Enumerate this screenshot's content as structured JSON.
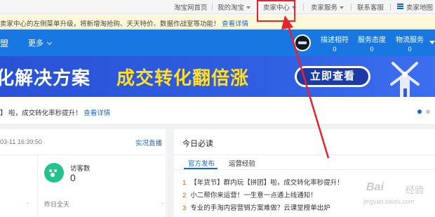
{
  "topnav": {
    "home": "淘宝网首页",
    "my_taobao": "我的淘宝",
    "seller_center": "卖家中心",
    "seller_service": "卖家服务",
    "contact": "联系客服",
    "seller_map": "卖家地图"
  },
  "notice": {
    "text": "卖家中心的左侧菜单升级，将新增淘抢购、天天特价、数据作战室等功能！",
    "link": "查看详情"
  },
  "header": {
    "brand": "盟",
    "more": "更多",
    "metrics": [
      {
        "label": "描述相符",
        "value": "0"
      },
      {
        "label": "服务态度",
        "value": "0"
      },
      {
        "label": "物流服务",
        "value": "0"
      }
    ]
  },
  "banner": {
    "text_white": "化解决方案",
    "text_yellow": "成交转化翻倍涨",
    "cta": "立即查看"
  },
  "news_bar": {
    "text": "】 啦，成交转化率秒提升！",
    "link": "查看详情"
  },
  "left_card": {
    "time": "03-11 16:39:50",
    "live": "实况直播",
    "visitors_label": "访客数",
    "visitors_value": "0",
    "dash_left": "-",
    "yesterday": "昨日全天",
    "dash_right": "-"
  },
  "right_card": {
    "title": "今日必读",
    "tabs": [
      "官方发布",
      "运营经验"
    ],
    "news": [
      {
        "n": "1",
        "text": "【年货节】群内玩【拼团】啦，成交转化率秒提升！"
      },
      {
        "n": "2",
        "text": "小二帮你来运营！一生意一点通上线通知！"
      },
      {
        "n": "3",
        "text": "专业的手淘内容营销方案难做？云课堂榜单出炉"
      }
    ]
  },
  "watermark": {
    "logo": "Bai",
    "logo2": "经验",
    "url": "jingyan.baidu.com"
  },
  "colors": {
    "brand_blue": "#1877e0",
    "annotation_red": "#e8222a",
    "banner_yellow": "#ffdf2b"
  }
}
